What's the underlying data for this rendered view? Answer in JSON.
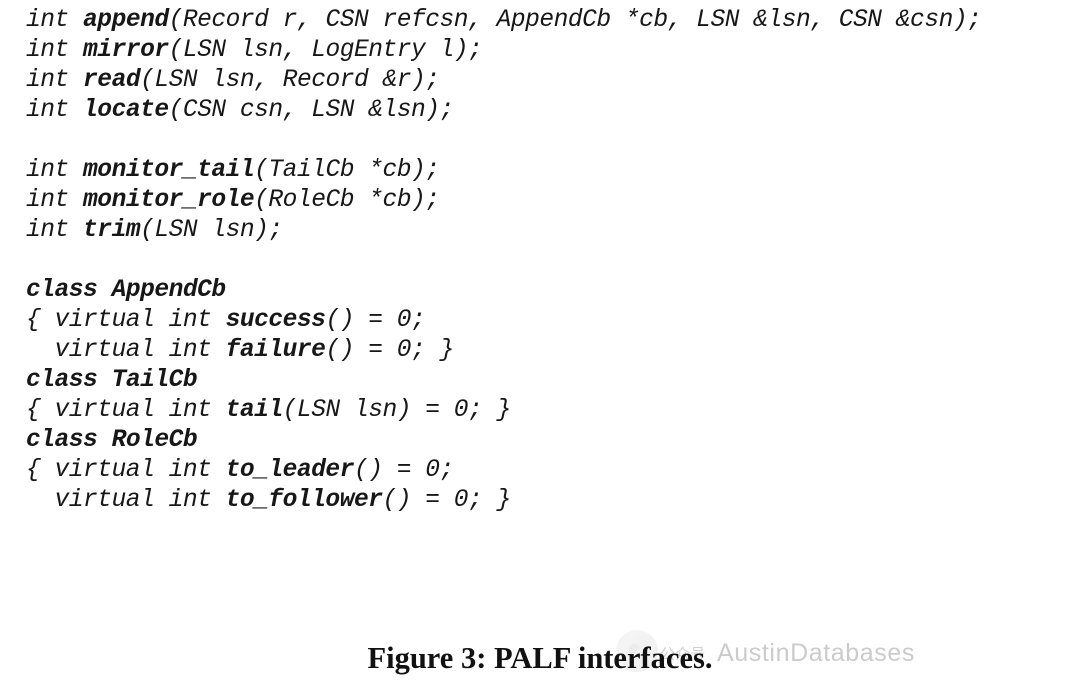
{
  "code": {
    "lines": [
      [
        {
          "t": "int ",
          "c": "i"
        },
        {
          "t": "append",
          "c": "i b"
        },
        {
          "t": "(Record r, CSN refcsn, AppendCb *cb, LSN &lsn, CSN &csn);",
          "c": "i"
        }
      ],
      [
        {
          "t": "int ",
          "c": "i"
        },
        {
          "t": "mirror",
          "c": "i b"
        },
        {
          "t": "(LSN lsn, LogEntry l);",
          "c": "i"
        }
      ],
      [
        {
          "t": "int ",
          "c": "i"
        },
        {
          "t": "read",
          "c": "i b"
        },
        {
          "t": "(LSN lsn, Record &r);",
          "c": "i"
        }
      ],
      [
        {
          "t": "int ",
          "c": "i"
        },
        {
          "t": "locate",
          "c": "i b"
        },
        {
          "t": "(CSN csn, LSN &lsn);",
          "c": "i"
        }
      ],
      [],
      [
        {
          "t": "int ",
          "c": "i"
        },
        {
          "t": "monitor_tail",
          "c": "i b"
        },
        {
          "t": "(TailCb *cb);",
          "c": "i"
        }
      ],
      [
        {
          "t": "int ",
          "c": "i"
        },
        {
          "t": "monitor_role",
          "c": "i b"
        },
        {
          "t": "(RoleCb *cb);",
          "c": "i"
        }
      ],
      [
        {
          "t": "int ",
          "c": "i"
        },
        {
          "t": "trim",
          "c": "i b"
        },
        {
          "t": "(LSN lsn);",
          "c": "i"
        }
      ],
      [],
      [
        {
          "t": "class ",
          "c": "i b"
        },
        {
          "t": "AppendCb",
          "c": "i b"
        }
      ],
      [
        {
          "t": "{ virtual int ",
          "c": "i"
        },
        {
          "t": "success",
          "c": "i b"
        },
        {
          "t": "() = 0;",
          "c": "i"
        }
      ],
      [
        {
          "t": "  virtual int ",
          "c": "i"
        },
        {
          "t": "failure",
          "c": "i b"
        },
        {
          "t": "() = 0; }",
          "c": "i"
        }
      ],
      [
        {
          "t": "class ",
          "c": "i b"
        },
        {
          "t": "TailCb",
          "c": "i b"
        }
      ],
      [
        {
          "t": "{ virtual int ",
          "c": "i"
        },
        {
          "t": "tail",
          "c": "i b"
        },
        {
          "t": "(LSN lsn) = 0; }",
          "c": "i"
        }
      ],
      [
        {
          "t": "class ",
          "c": "i b"
        },
        {
          "t": "RoleCb",
          "c": "i b"
        }
      ],
      [
        {
          "t": "{ virtual int ",
          "c": "i"
        },
        {
          "t": "to_leader",
          "c": "i b"
        },
        {
          "t": "() = 0;",
          "c": "i"
        }
      ],
      [
        {
          "t": "  virtual int ",
          "c": "i"
        },
        {
          "t": "to_follower",
          "c": "i b"
        },
        {
          "t": "() = 0; }",
          "c": "i"
        }
      ]
    ]
  },
  "caption": "Figure 3: PALF interfaces.",
  "watermark": {
    "badge": "公众号",
    "source": "AustinDatabases"
  }
}
